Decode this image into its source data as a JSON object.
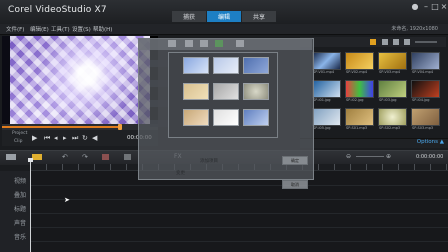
{
  "app": {
    "title": "Corel VideoStudio X7"
  },
  "workspace_tabs": [
    {
      "label": "捕获",
      "active": false
    },
    {
      "label": "编辑",
      "active": true
    },
    {
      "label": "共享",
      "active": false
    }
  ],
  "menu": [
    "文件(F)",
    "编辑(E)",
    "工具(T)",
    "设置(S)",
    "帮助(H)"
  ],
  "project_info": "未命名, 1920x1080",
  "preview": {
    "mode_project": "Project",
    "mode_clip": "Clip",
    "timecode": "00:00:00"
  },
  "library": {
    "thumb_labels": [
      "SP-V01.mp4",
      "SP-V02.mp4",
      "SP-V03.mp4",
      "SP-V04.mp4",
      "SP-I01.jpg",
      "SP-I02.jpg",
      "SP-I03.jpg",
      "SP-I04.jpg",
      "SP-I05.jpg",
      "SP-S01.mp3",
      "SP-S02.mp3",
      "SP-S03.mp3"
    ],
    "options_label": "Options ▲"
  },
  "dialog": {
    "field1_label": "添加项目",
    "field2_label": "变更",
    "ok_label": "确定",
    "cancel_label": "取消"
  },
  "timeline": {
    "timecode": "0:00:00:00",
    "tracks": [
      "视频",
      "叠加",
      "标题",
      "声音",
      "音乐"
    ]
  },
  "colors": {
    "accent": "#1d7fc4",
    "scrub": "#e07c1e",
    "options": "#4ba8ec"
  }
}
